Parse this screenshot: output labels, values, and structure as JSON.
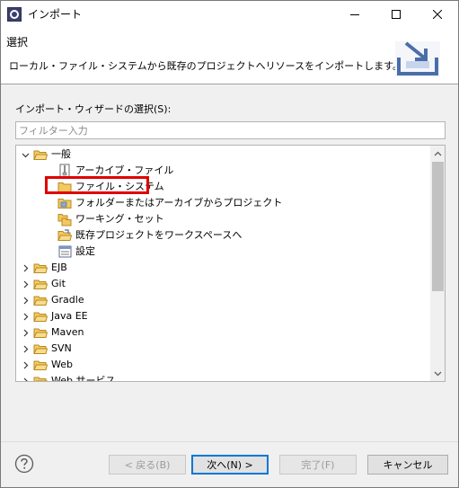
{
  "window": {
    "title": "インポート"
  },
  "banner": {
    "title": "選択",
    "description": "ローカル・ファイル・システムから既存のプロジェクトへリソースをインポートします。"
  },
  "wizard": {
    "select_label": "インポート・ウィザードの選択(S):",
    "filter_placeholder": "フィルター入力",
    "filter_value": ""
  },
  "tree": {
    "root": {
      "label": "一般",
      "expanded": true
    },
    "children": [
      {
        "label": "アーカイブ・ファイル",
        "icon": "archive-file-icon"
      },
      {
        "label": "ファイル・システム",
        "icon": "folder-icon",
        "highlighted": true
      },
      {
        "label": "フォルダーまたはアーカイブからプロジェクト",
        "icon": "project-folder-icon"
      },
      {
        "label": "ワーキング・セット",
        "icon": "working-set-icon"
      },
      {
        "label": "既存プロジェクトをワークスペースへ",
        "icon": "open-project-icon"
      },
      {
        "label": "設定",
        "icon": "preferences-icon"
      }
    ],
    "categories": [
      {
        "label": "EJB"
      },
      {
        "label": "Git"
      },
      {
        "label": "Gradle"
      },
      {
        "label": "Java EE"
      },
      {
        "label": "Maven"
      },
      {
        "label": "SVN"
      },
      {
        "label": "Web"
      },
      {
        "label": "Web サービス"
      }
    ]
  },
  "buttons": {
    "back": "< 戻る(B)",
    "next": "次へ(N) >",
    "finish": "完了(F)",
    "cancel": "キャンセル"
  },
  "colors": {
    "highlight_border": "#e00000",
    "default_button_border": "#0078d7",
    "folder_fill": "#f3c962"
  }
}
